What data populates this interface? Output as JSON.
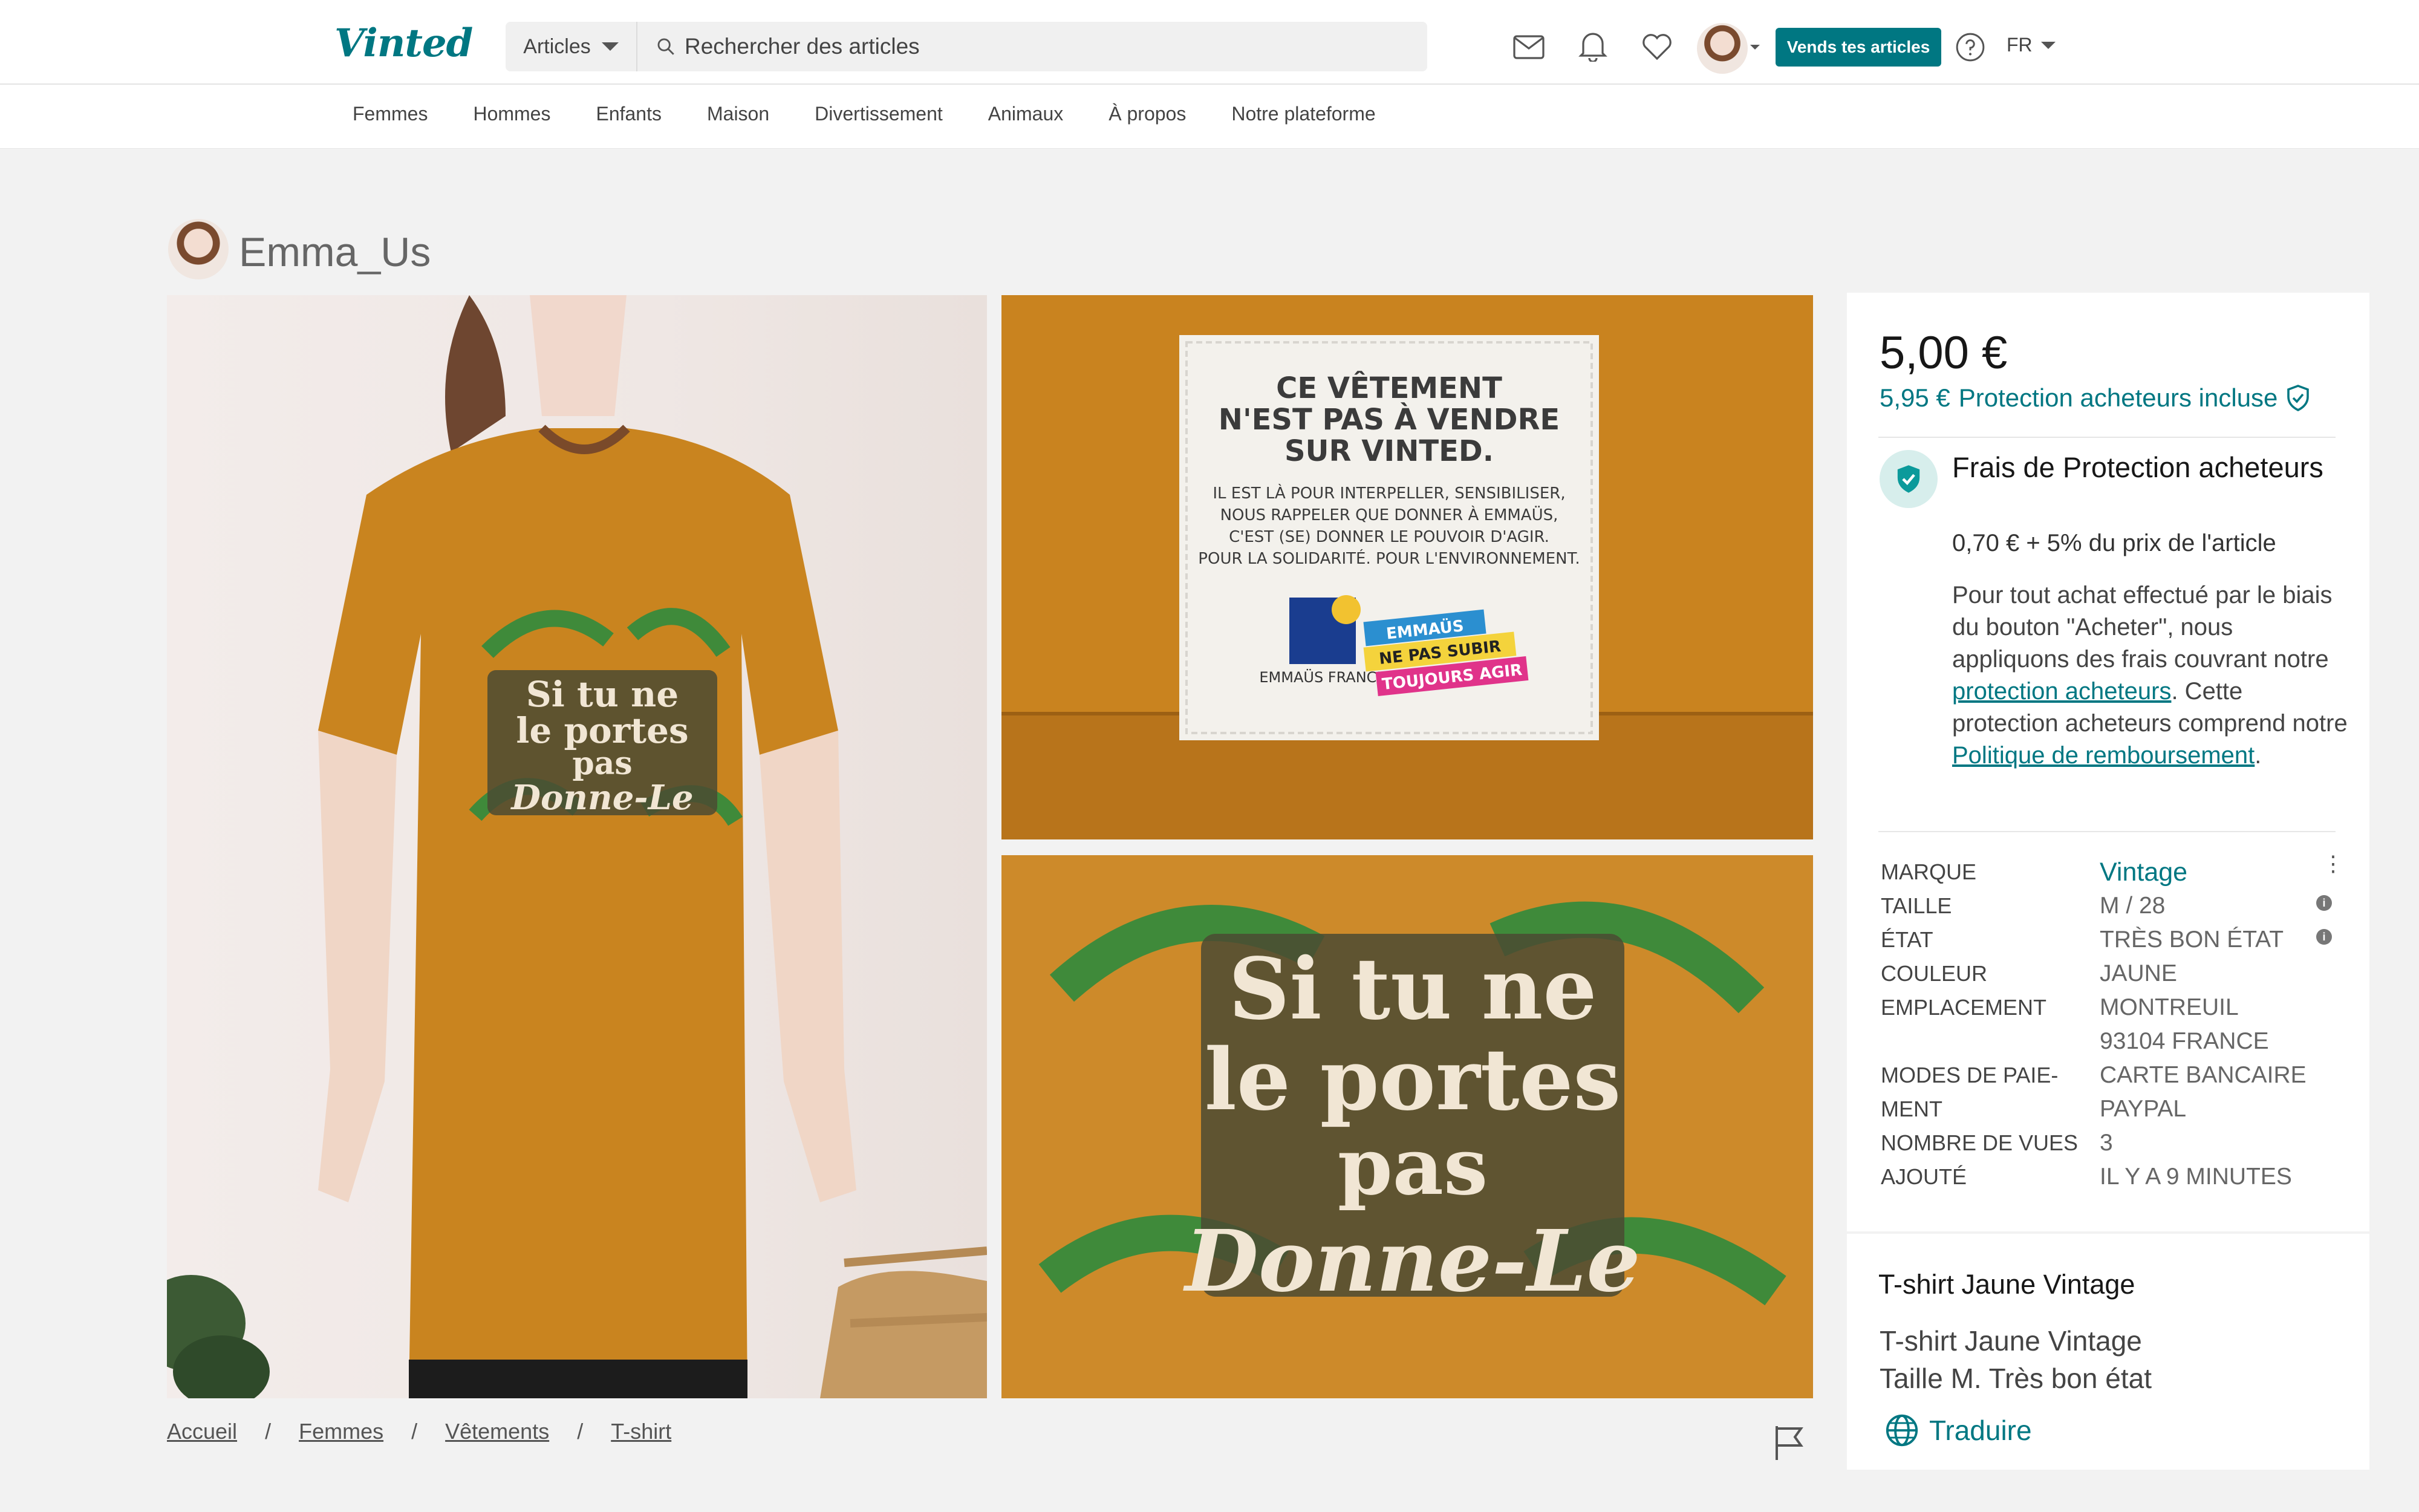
{
  "brand": {
    "logo": "Vinted",
    "accent": "#007782"
  },
  "search": {
    "category": "Articles",
    "placeholder": "Rechercher des articles"
  },
  "header": {
    "sell_label": "Vends tes articles",
    "language": "FR"
  },
  "nav": {
    "items": [
      "Femmes",
      "Hommes",
      "Enfants",
      "Maison",
      "Divertissement",
      "Animaux",
      "À propos",
      "Notre plateforme"
    ]
  },
  "seller": {
    "username": "Emma_Us"
  },
  "photos": {
    "label": {
      "line1": "CE VÊTEMENT",
      "line2": "N'EST PAS À VENDRE",
      "line3": "SUR VINTED.",
      "small1": "IL EST LÀ POUR INTERPELLER, SENSIBILISER,",
      "small2": "NOUS RAPPELER QUE DONNER À EMMAÜS,",
      "small3": "C'EST (SE) DONNER LE POUVOIR D'AGIR.",
      "small4": "POUR LA SOLIDARITÉ. POUR L'ENVIRONNEMENT.",
      "emmaus": "EMMAÜS",
      "emmaus_country": "EMMAÜS FRANCE",
      "slogan1": "NE PAS SUBIR",
      "slogan2": "TOUJOURS AGIR"
    },
    "print": {
      "line1": "Si tu ne",
      "line2": "le portes",
      "line3": "pas",
      "line4": "Donne-Le"
    }
  },
  "item": {
    "price": "5,00 €",
    "protected_price": "5,95 €",
    "protection_label": "Protection acheteurs incluse",
    "fee_title": "Frais de Protection acheteurs",
    "fee_subtitle": "0,70 € + 5% du prix de l'article",
    "fee_desc_1": "Pour tout achat effectué par le biais du bouton \"Acheter\", nous appliquons des frais couvrant notre ",
    "fee_link_1": "protection acheteurs",
    "fee_desc_2": ". Cette protection acheteurs comprend notre ",
    "fee_link_2": "Politique de remboursement",
    "fee_desc_3": ".",
    "details": [
      {
        "label": "Marque",
        "value": "Vintage"
      },
      {
        "label": "Taille",
        "value": "M / 28"
      },
      {
        "label": "État",
        "value": "Très bon état"
      },
      {
        "label": "Couleur",
        "value": "Jaune"
      },
      {
        "label": "Emplacement",
        "value": "Montreuil"
      },
      {
        "label": "",
        "value": "93104 France"
      },
      {
        "label": "Modes de paie-",
        "value": "Carte bancaire"
      },
      {
        "label": "ment",
        "value": "PayPal"
      },
      {
        "label": "Nombre de vues",
        "value": "3"
      },
      {
        "label": "Ajouté",
        "value": "Il y a 9 minutes"
      }
    ],
    "title": "T-shirt Jaune Vintage",
    "description_1": "T-shirt Jaune Vintage",
    "description_2": "Taille M. Très bon état",
    "translate": "Traduire"
  },
  "breadcrumbs": [
    "Accueil",
    "Femmes",
    "Vêtements",
    "T-shirt"
  ]
}
